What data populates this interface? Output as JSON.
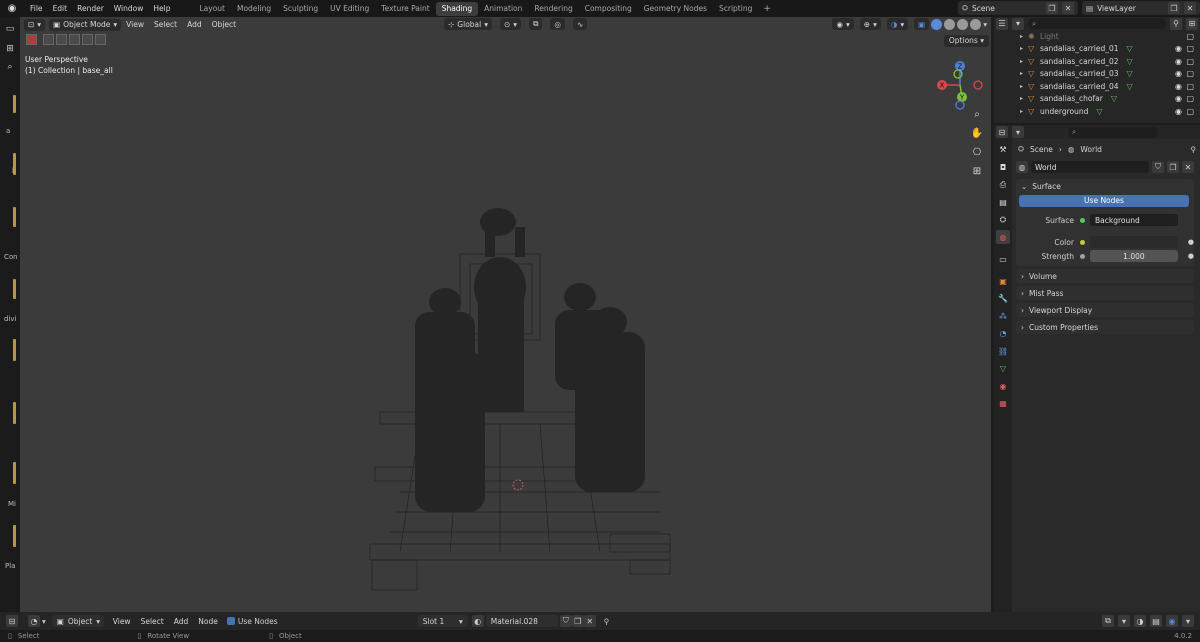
{
  "menubar": {
    "items": [
      "File",
      "Edit",
      "Render",
      "Window",
      "Help"
    ],
    "workspaces": [
      "Layout",
      "Modeling",
      "Sculpting",
      "UV Editing",
      "Texture Paint",
      "Shading",
      "Animation",
      "Rendering",
      "Compositing",
      "Geometry Nodes",
      "Scripting"
    ],
    "active_workspace": "Shading",
    "add_tab": "+",
    "scene": "Scene",
    "view_layer": "ViewLayer"
  },
  "left_strip": {
    "labels": [
      "a",
      "l",
      "Con",
      "divi",
      "Mi",
      "Pla"
    ]
  },
  "viewport": {
    "mode": "Object Mode",
    "menus": [
      "View",
      "Select",
      "Add",
      "Object"
    ],
    "orientation": "Global",
    "options": "Options",
    "info_line1": "User Perspective",
    "info_line2": "(1) Collection | base_all",
    "gizmo": {
      "z": "Z",
      "y": "Y",
      "x": "X"
    }
  },
  "outliner": {
    "rows": [
      {
        "name": "Light",
        "dim": true
      },
      {
        "name": "sandalias_carried_01",
        "dim": false
      },
      {
        "name": "sandalias_carried_02",
        "dim": false
      },
      {
        "name": "sandalias_carried_03",
        "dim": false
      },
      {
        "name": "sandalias_carried_04",
        "dim": false
      },
      {
        "name": "sandalias_chofar",
        "dim": false
      },
      {
        "name": "underground",
        "dim": false
      }
    ]
  },
  "properties": {
    "crumb_scene": "Scene",
    "crumb_world": "World",
    "world_name": "World",
    "surface_panel": "Surface",
    "use_nodes": "Use Nodes",
    "surface_label": "Surface",
    "surface_value": "Background",
    "color_label": "Color",
    "strength_label": "Strength",
    "strength_value": "1.000",
    "collapsed": [
      "Volume",
      "Mist Pass",
      "Viewport Display",
      "Custom Properties"
    ]
  },
  "node_header": {
    "type": "Object",
    "menus": [
      "View",
      "Select",
      "Add",
      "Node"
    ],
    "use_nodes": "Use Nodes",
    "slot": "Slot 1",
    "material": "Material.028"
  },
  "statusbar": {
    "select": "Select",
    "rotate": "Rotate View",
    "object": "Object",
    "version": "4.0.2"
  },
  "colors": {
    "accent": "#4772b3",
    "object_orange": "#e08a3a",
    "mesh_green": "#5ec45e",
    "viewport_bg": "#3b3b3b"
  }
}
